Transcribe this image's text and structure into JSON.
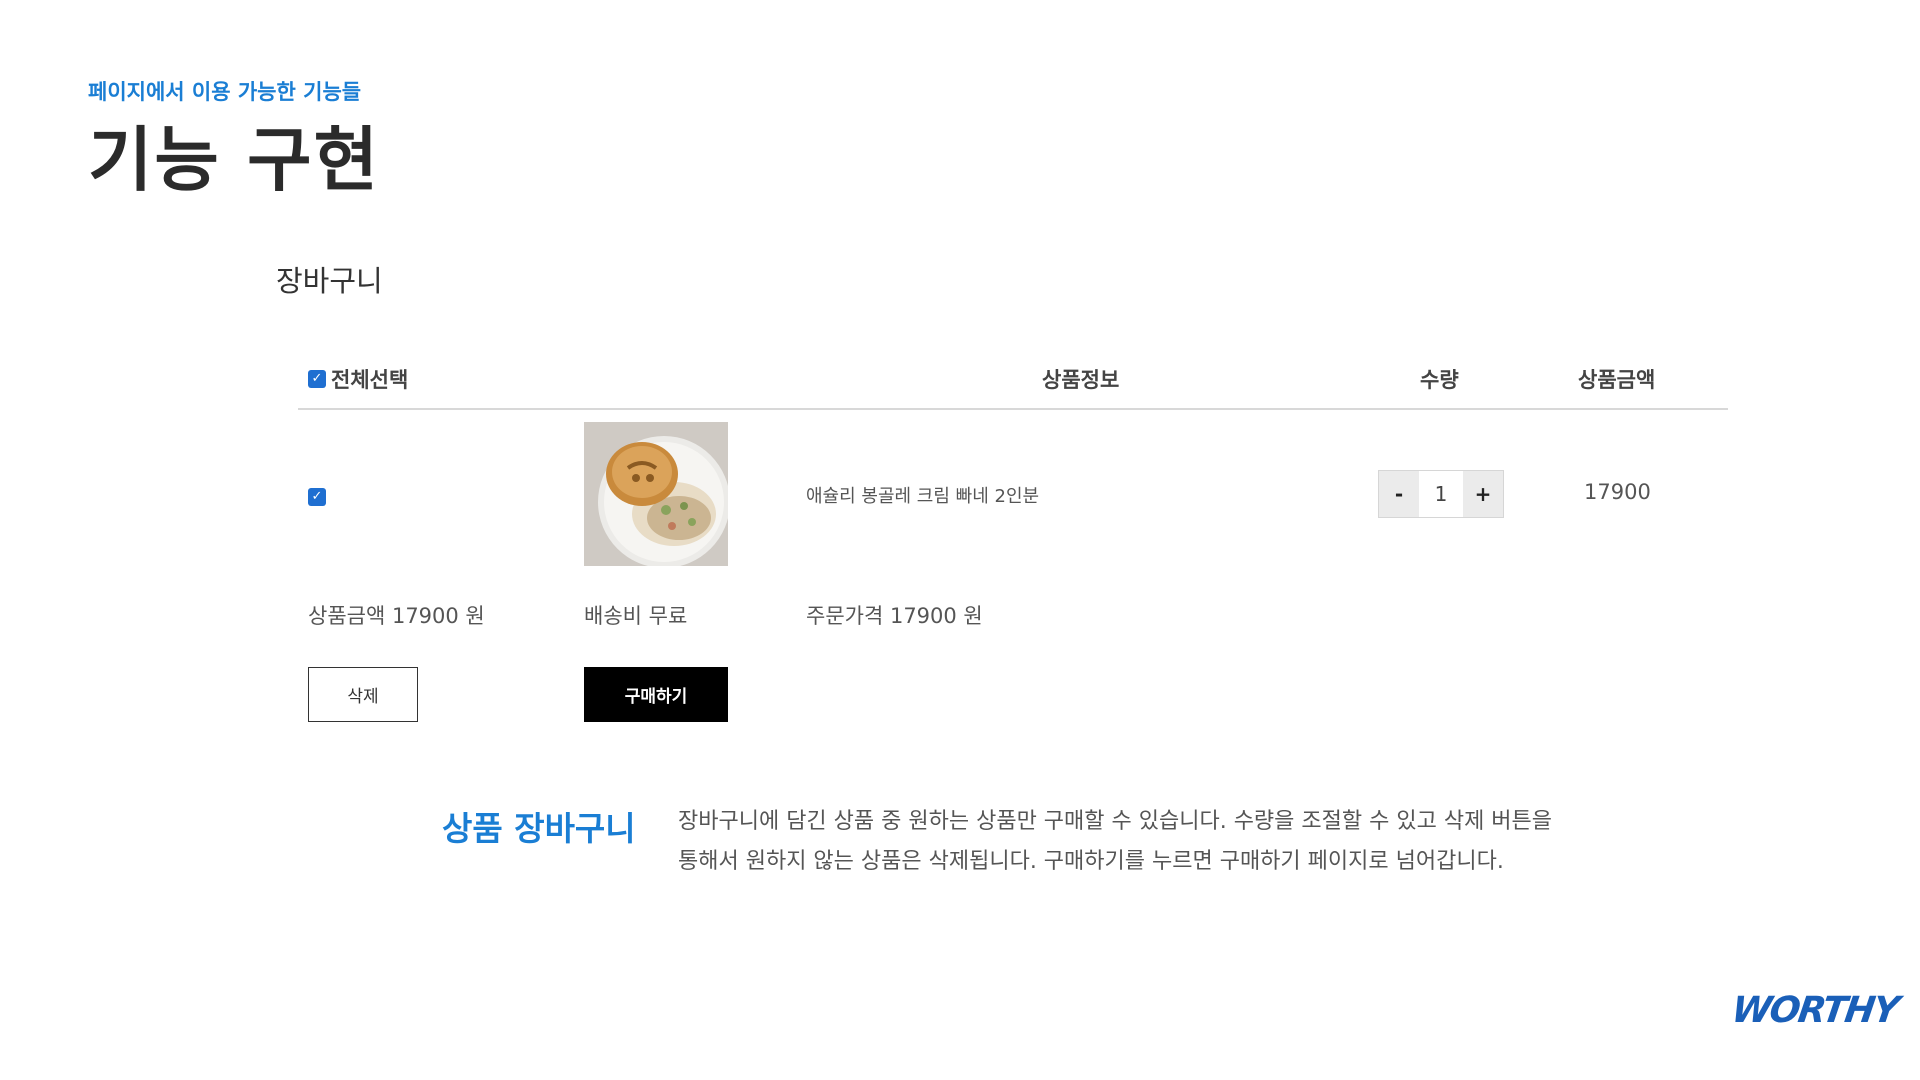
{
  "slide": {
    "subtitle": "페이지에서 이용 가능한 기능들",
    "title": "기능 구현",
    "logo": "WORTHY"
  },
  "cart": {
    "title": "장바구니",
    "headers": {
      "select_all": "전체선택",
      "product_info": "상품정보",
      "quantity": "수량",
      "price": "상품금액"
    },
    "item": {
      "checked": true,
      "name": "애슐리 봉골레 크림 빠네 2인분",
      "quantity": "1",
      "minus": "-",
      "plus": "+",
      "price": "17900"
    },
    "summary": {
      "product_total": "상품금액 17900 원",
      "shipping": "배송비 무료",
      "order_total": "주문가격 17900 원"
    },
    "buttons": {
      "delete": "삭제",
      "buy": "구매하기"
    }
  },
  "feature": {
    "title": "상품 장바구니",
    "description_line1": "장바구니에 담긴 상품 중 원하는 상품만 구매할 수 있습니다. 수량을 조절할 수 있고 삭제 버튼을",
    "description_line2": "통해서 원하지 않는 상품은 삭제됩니다.  구매하기를 누르면 구매하기 페이지로 넘어갑니다."
  },
  "colors": {
    "accent": "#1a7ed4",
    "checkbox": "#1f6fd1",
    "buy_button": "#000000"
  }
}
